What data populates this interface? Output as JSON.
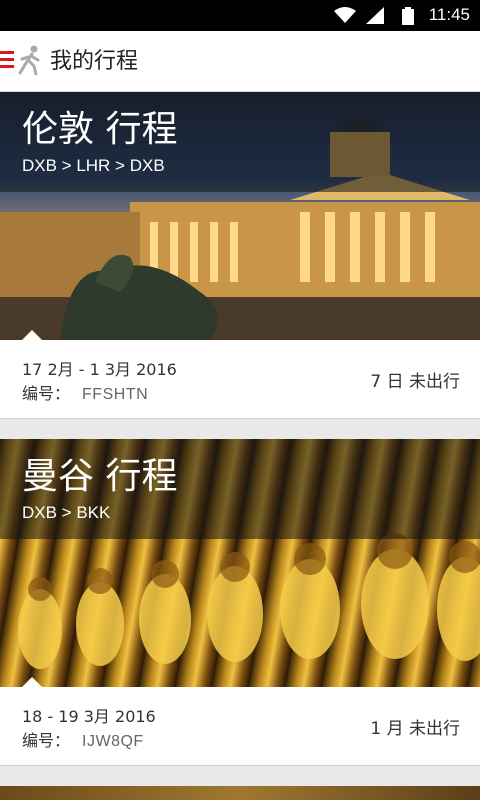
{
  "status_bar": {
    "time": "11:45",
    "icons": [
      "wifi-icon",
      "cell-signal-icon",
      "battery-icon"
    ]
  },
  "app_bar": {
    "title": "我的行程",
    "menu_icon": "hamburger-menu-icon",
    "logo_icon": "walking-person-icon"
  },
  "colors": {
    "accent": "#d71921",
    "card_bg": "#ffffff",
    "page_bg": "#e9e9e9"
  },
  "trips": [
    {
      "city": "伦敦 行程",
      "route": "DXB > LHR > DXB",
      "dates": "17 2月 - 1 3月 2016",
      "ref_label": "编号：",
      "ref_code": "FFSHTN",
      "status": "7 日 未出行"
    },
    {
      "city": "曼谷 行程",
      "route": "DXB > BKK",
      "dates": "18 - 19 3月 2016",
      "ref_label": "编号：",
      "ref_code": "IJW8QF",
      "status": "1 月 未出行"
    }
  ]
}
